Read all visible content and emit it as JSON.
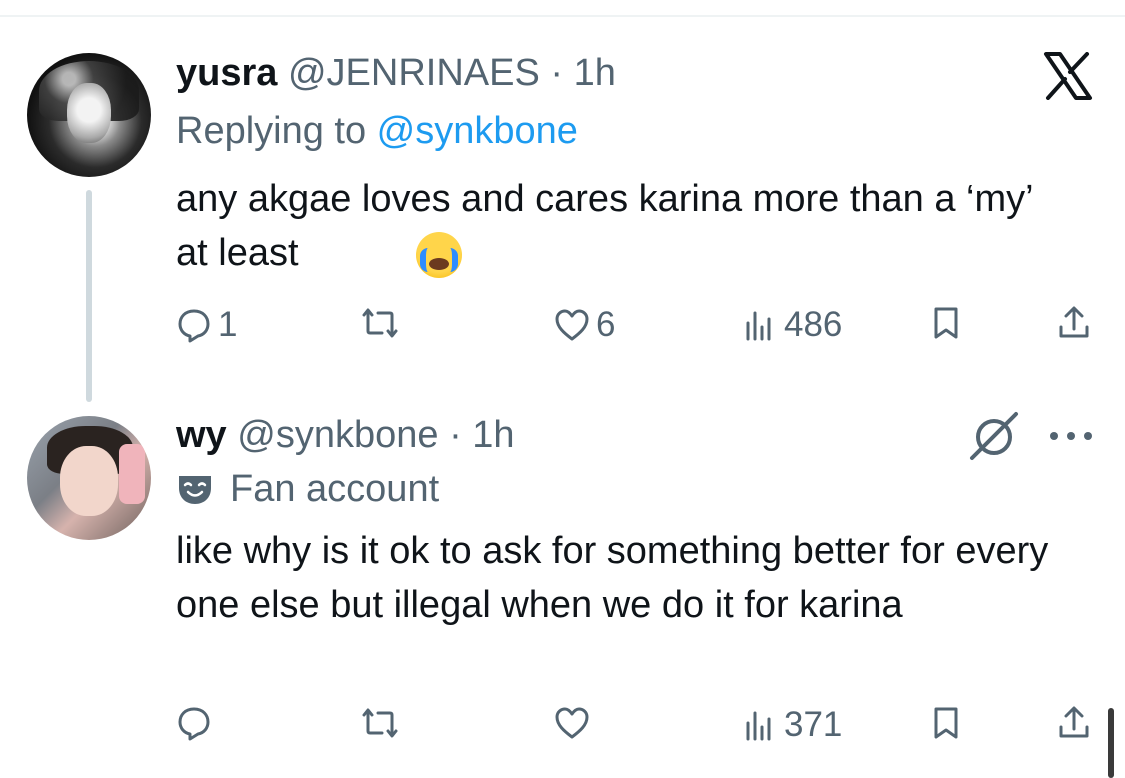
{
  "tweets": [
    {
      "name": "yusra",
      "handle": "@JENRINAES",
      "time": "· 1h",
      "replying_prefix": "Replying to ",
      "replying_to": "@synkbone",
      "text": "any akgae loves and cares karina more than a ‘my’ at least",
      "emoji": "loudly-crying-face",
      "stats": {
        "replies": "1",
        "retweets": "",
        "likes": "6",
        "views": "486"
      }
    },
    {
      "name": "wy",
      "handle": "@synkbone",
      "time": "· 1h",
      "label": "Fan account",
      "text": "like why is it ok to ask for something better for every one else but illegal when we do it for karina",
      "stats": {
        "replies": "",
        "retweets": "",
        "likes": "",
        "views": "371"
      }
    }
  ],
  "icons": [
    "x-logo-icon",
    "no-symbol-icon",
    "more-icon",
    "reply-icon",
    "retweet-icon",
    "like-icon",
    "views-icon",
    "bookmark-icon",
    "share-icon",
    "theater-mask-icon"
  ],
  "colors": {
    "text": "#0f1419",
    "secondary": "#536471",
    "link": "#1d9bf0",
    "thread": "#cfd9de"
  }
}
